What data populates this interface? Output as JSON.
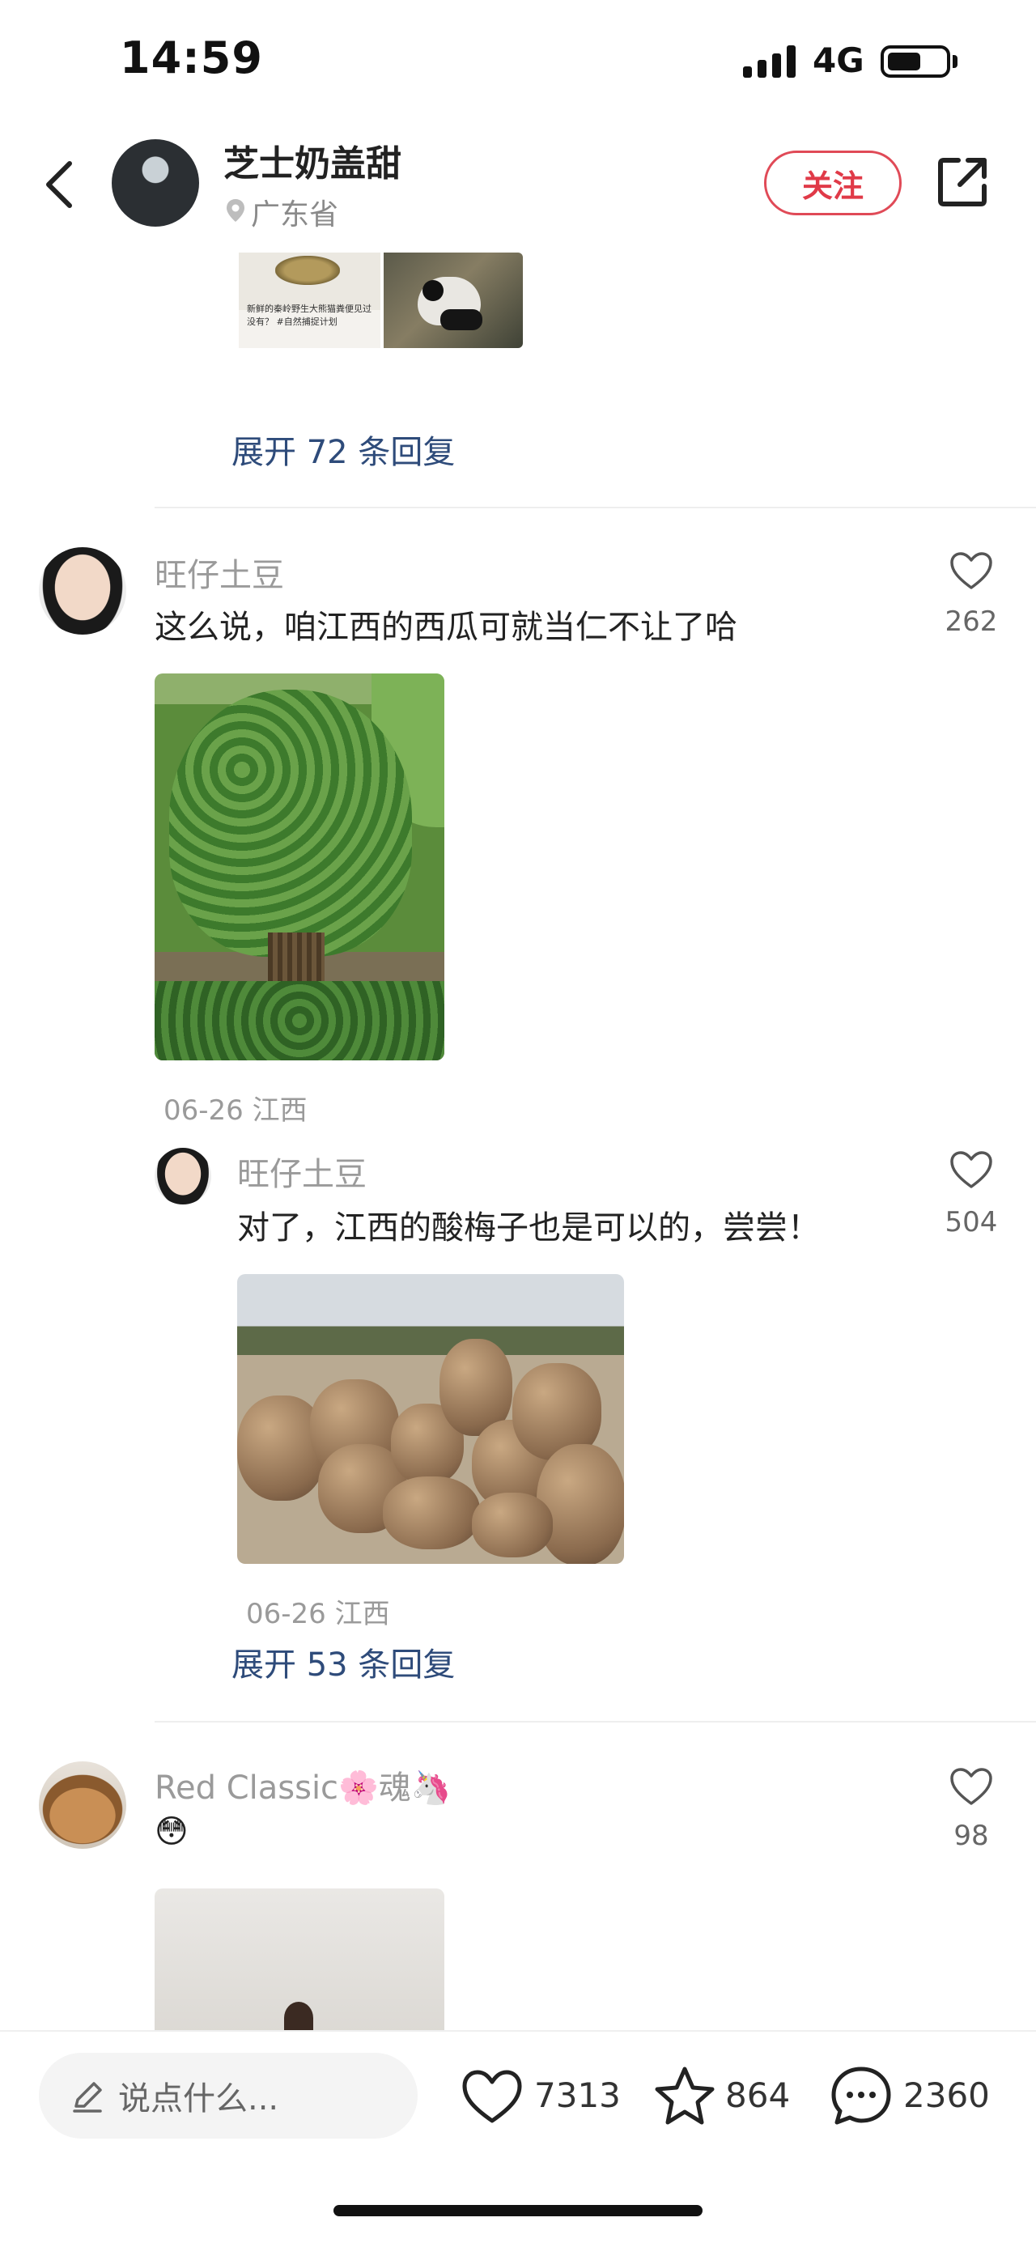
{
  "status_bar": {
    "time": "14:59",
    "network": "4G"
  },
  "header": {
    "author": "芝士奶盖甜",
    "location": "广东省",
    "follow_label": "关注"
  },
  "top_thread": {
    "thumb_caption": "新鲜的秦岭野生大熊猫粪便见过没有？ #自然捕捉计划",
    "expand_label": "展开 72 条回复"
  },
  "comments": [
    {
      "user": "旺仔土豆",
      "text": "这么说，咱江西的西瓜可就当仁不让了哈",
      "likes": "262",
      "meta": "06-26 江西",
      "reply": {
        "user": "旺仔土豆",
        "text": "对了，江西的酸梅子也是可以的，尝尝！",
        "likes": "504",
        "meta": "06-26 江西"
      },
      "expand_label": "展开 53 条回复"
    },
    {
      "user": "Red Classic🌸魂🦄",
      "text": "😳",
      "likes": "98"
    }
  ],
  "bottom_bar": {
    "input_placeholder": "说点什么...",
    "likes": "7313",
    "stars": "864",
    "comments": "2360"
  },
  "colors": {
    "accent_red": "#e03a48",
    "link_blue": "#2e4b7a"
  }
}
